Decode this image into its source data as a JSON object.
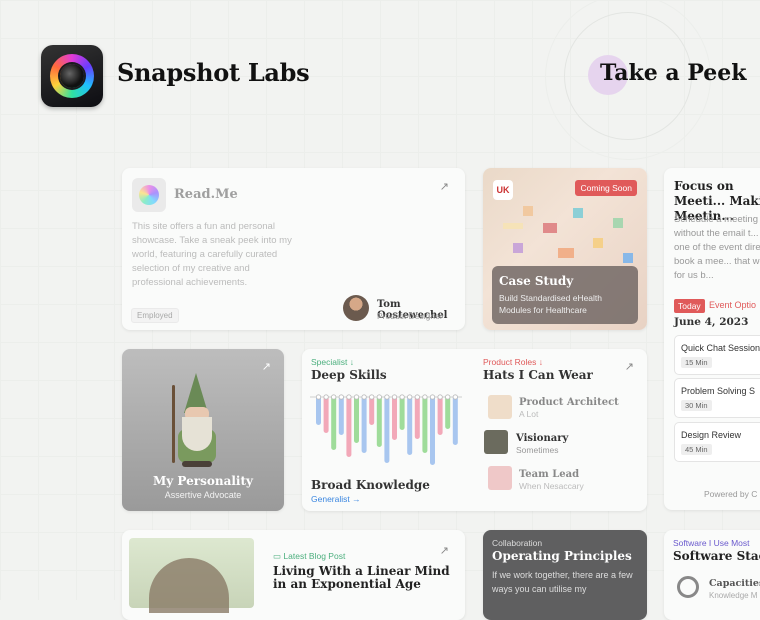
{
  "header": {
    "brand": "Snapshot Labs",
    "cta": "Take a Peek"
  },
  "readme": {
    "title": "Read.Me",
    "text": "This site offers a fun and personal showcase. Take a sneak peek into my world, featuring a carefully curated selection of my creative and professional achievements.",
    "badge": "Employed",
    "person_name": "Tom Oostewechel",
    "person_role": "Product Designer",
    "arrow": "↗"
  },
  "case_study": {
    "flag": "UK",
    "badge": "Coming Soon",
    "title": "Case Study",
    "subtitle": "Build Standardised eHealth Modules for Healthcare"
  },
  "schedule": {
    "heading": "Focus on Meeti... Making Meetin...",
    "text": "Schedule a meeting without the email t... on one of the event directly book a mee... that works for us b...",
    "today": "Today",
    "event_options": "Event Optio",
    "date": "June 4, 2023",
    "slots": [
      {
        "name": "Quick Chat Session",
        "duration": "15 Min"
      },
      {
        "name": "Problem Solving S",
        "duration": "30 Min"
      },
      {
        "name": "Design Review",
        "duration": "45 Min"
      }
    ],
    "powered": "Powered by C"
  },
  "personality": {
    "title": "My Personality",
    "subtitle": "Assertive Advocate",
    "arrow": "↗"
  },
  "skills": {
    "specialist": "Specialist ↓",
    "deep_title": "Deep Skills",
    "broad_title": "Broad Knowledge",
    "generalist": "Generalist →",
    "roles_label": "Product Roles ↓",
    "roles_title": "Hats I Can Wear",
    "arrow": "↗",
    "roles": [
      {
        "name": "Product Architect",
        "freq": "A Lot"
      },
      {
        "name": "Visionary",
        "freq": "Sometimes"
      },
      {
        "name": "Team Lead",
        "freq": "When Nesaccary"
      }
    ],
    "bar_colors": [
      "#a8c6ef",
      "#f2a8b8",
      "#9fdc9a"
    ]
  },
  "blog": {
    "label": "Latest Blog Post",
    "title": "Living With a Linear Mind in an Exponential Age",
    "arrow": "↗"
  },
  "ops": {
    "label": "Collaboration",
    "title": "Operating Principles",
    "text": "If we work together, there are a few ways you can utilise my"
  },
  "stack": {
    "label": "Software I Use Most",
    "title": "Software Stack",
    "item_name": "Capacities",
    "item_sub": "Knowledge M"
  }
}
